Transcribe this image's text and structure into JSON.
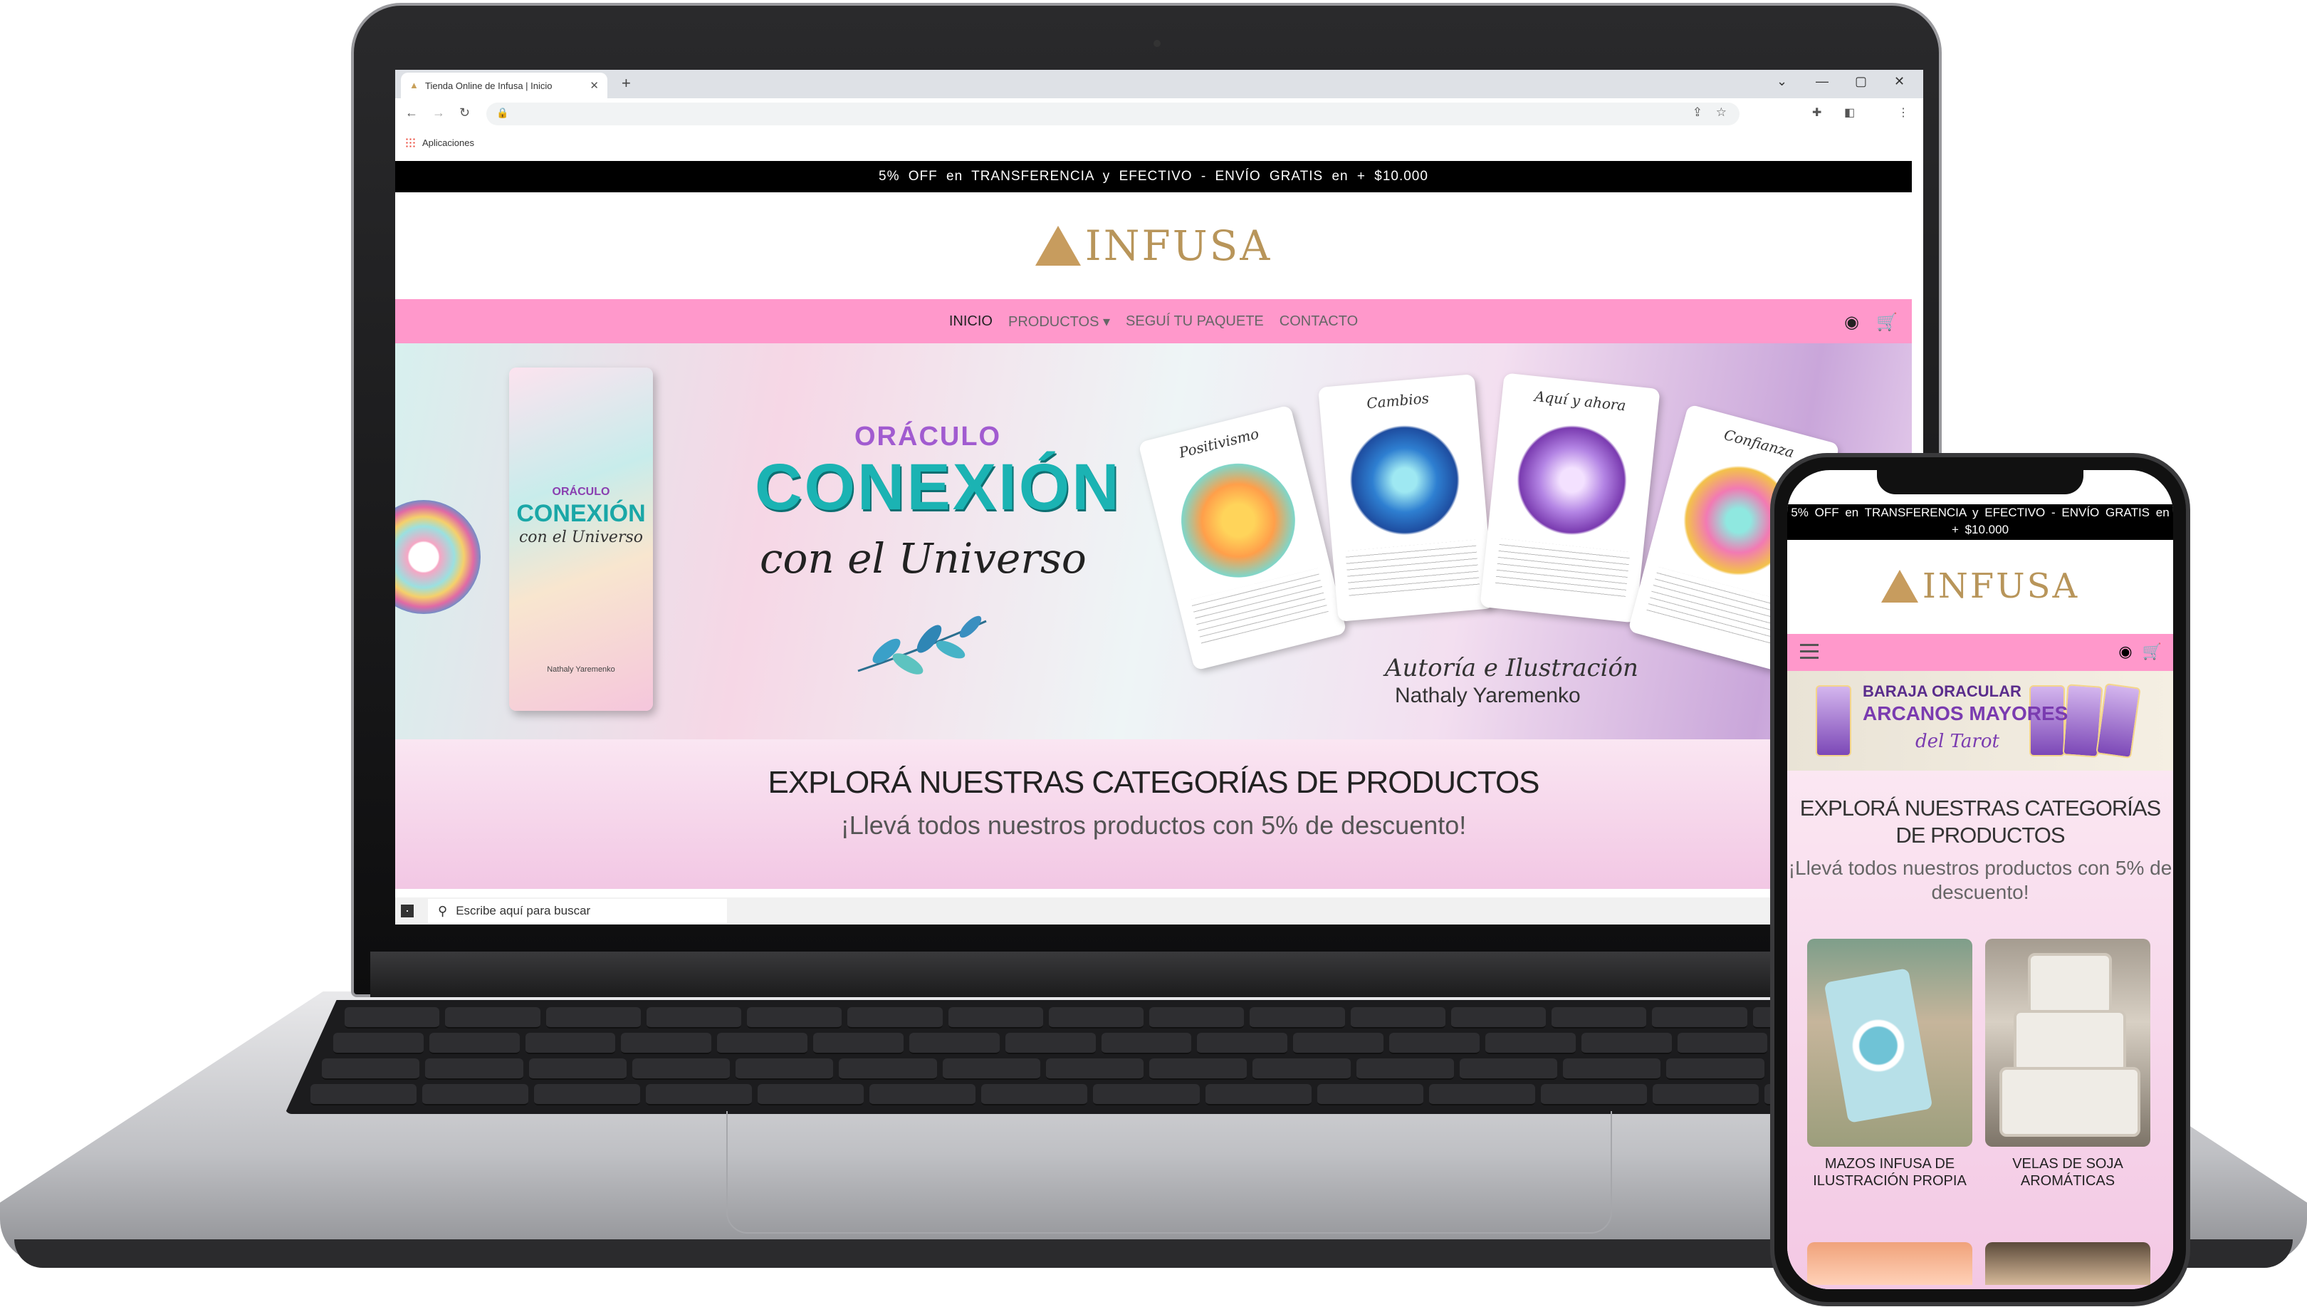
{
  "browser": {
    "tab_title": "Tienda Online de Infusa | Inicio",
    "tab_close": "✕",
    "new_tab": "+",
    "bookmarks_label": "Aplicaciones",
    "win_min": "—",
    "win_max": "▢",
    "win_close": "✕",
    "win_chevron": "⌄"
  },
  "site": {
    "promo_text": "5% OFF en TRANSFERENCIA y EFECTIVO - ENVÍO GRATIS en + $10.000",
    "logo_text": "INFUSA",
    "nav": [
      "INICIO",
      "PRODUCTOS ▾",
      "SEGUÍ TU PAQUETE",
      "CONTACTO"
    ],
    "hero": {
      "kicker": "ORÁCULO",
      "title": "CONEXIÓN",
      "subtitle": "con el Universo",
      "book_kicker": "ORÁCULO",
      "book_title": "CONEXIÓN",
      "book_subtitle": "con el Universo",
      "book_author": "Nathaly Yaremenko",
      "card_titles": [
        "Positivismo",
        "Cambios",
        "Aquí y ahora",
        "Confianza"
      ],
      "author_label": "Autoría e Ilustración",
      "author_name": "Nathaly Yaremenko"
    },
    "categories_heading": "EXPLORÁ NUESTRAS CATEGORÍAS DE PRODUCTOS",
    "categories_sub": "¡Llevá todos nuestros productos con 5% de descuento!"
  },
  "taskbar": {
    "search_placeholder": "Escribe aquí para buscar"
  },
  "phone": {
    "promo_text": "5% OFF en TRANSFERENCIA y EFECTIVO - ENVÍO GRATIS en + $10.000",
    "logo_text": "INFUSA",
    "banner_line1": "BARAJA ORACULAR",
    "banner_line2": "ARCANOS MAYORES",
    "banner_line3": "del Tarot",
    "categories_heading": "EXPLORÁ NUESTRAS CATEGORÍAS DE PRODUCTOS",
    "categories_sub": "¡Llevá todos nuestros productos con 5% de descuento!",
    "products": [
      {
        "label": "MAZOS INFUSA DE ILUSTRACIÓN PROPIA"
      },
      {
        "label": "VELAS DE SOJA AROMÁTICAS"
      }
    ]
  },
  "colors": {
    "nav_pink": "#ff98cb",
    "logo_gold": "#b8955a",
    "hero_teal": "#1bb3b3",
    "hero_purple": "#a15bd0"
  },
  "icons": [
    "user-icon",
    "cart-icon",
    "windows-logo-icon",
    "search-icon",
    "menu-icon",
    "star-icon",
    "share-icon",
    "extensions-icon",
    "lock-icon"
  ]
}
